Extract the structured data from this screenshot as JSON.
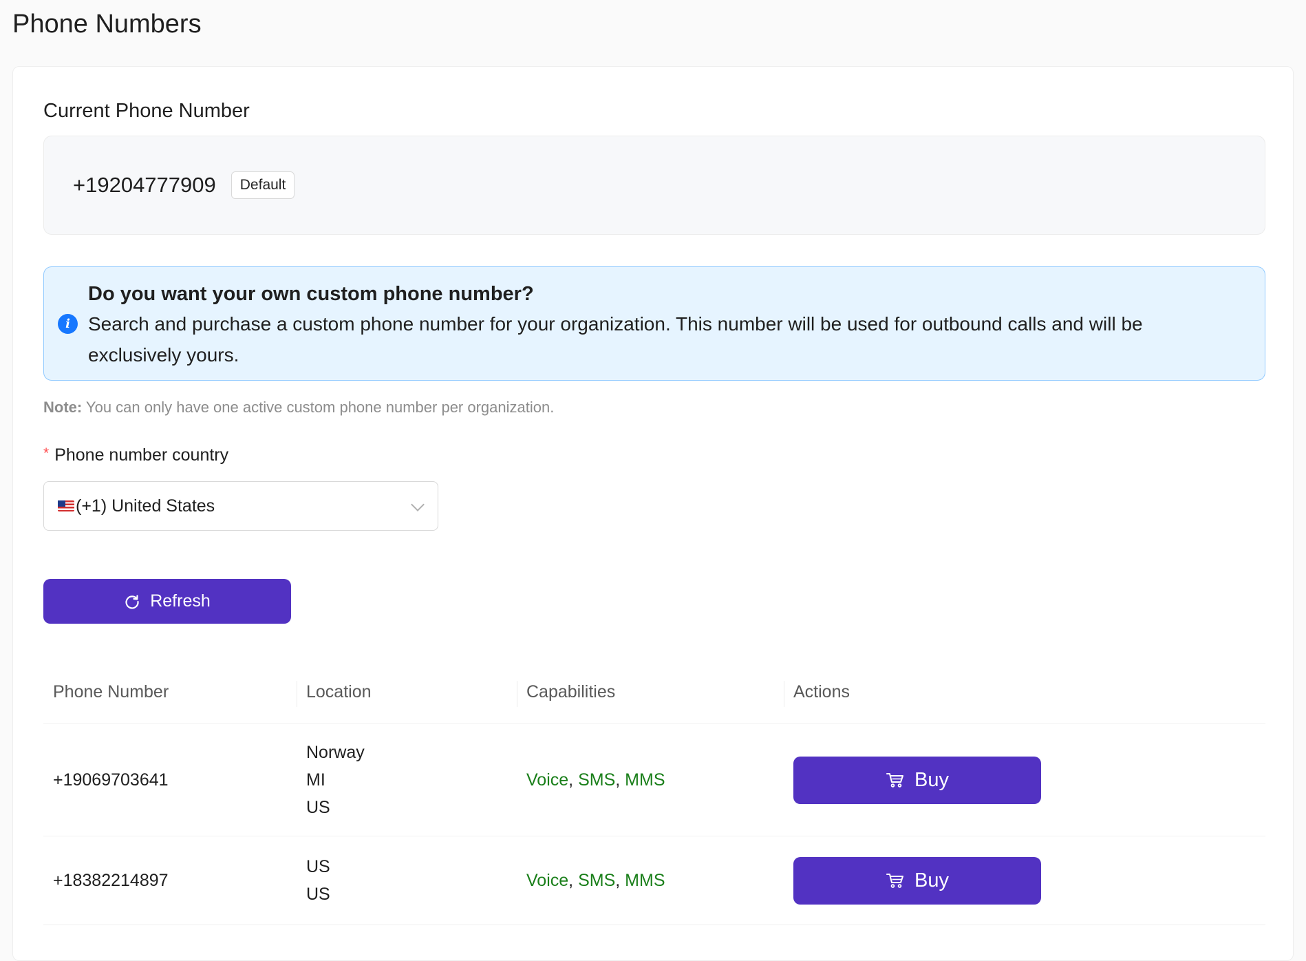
{
  "page": {
    "title": "Phone Numbers"
  },
  "current": {
    "section_title": "Current Phone Number",
    "number": "+19204777909",
    "tag": "Default"
  },
  "alert": {
    "title": "Do you want your own custom phone number?",
    "description": "Search and purchase a custom phone number for your organization. This number will be used for outbound calls and will be exclusively yours.",
    "icon": "info-icon"
  },
  "note": {
    "label": "Note:",
    "text": " You can only have one active custom phone number per organization."
  },
  "country_field": {
    "required_mark": "*",
    "label": "Phone number country",
    "value": "(+1) United States"
  },
  "refresh_button": {
    "label": "Refresh"
  },
  "table": {
    "headers": [
      "Phone Number",
      "Location",
      "Capabilities",
      "Actions"
    ],
    "rows": [
      {
        "phone": "+19069703641",
        "location": [
          "Norway",
          "MI",
          "US"
        ],
        "capabilities": [
          "Voice",
          "SMS",
          "MMS"
        ],
        "action": "Buy"
      },
      {
        "phone": "+18382214897",
        "location": [
          "US",
          "US"
        ],
        "capabilities": [
          "Voice",
          "SMS",
          "MMS"
        ],
        "action": "Buy"
      }
    ]
  },
  "colors": {
    "primary": "#5232c2",
    "capability": "#1a7f1a",
    "info": "#1677ff",
    "alert_bg": "#e6f4ff",
    "alert_border": "#91caff",
    "required": "#ff4d4f"
  }
}
